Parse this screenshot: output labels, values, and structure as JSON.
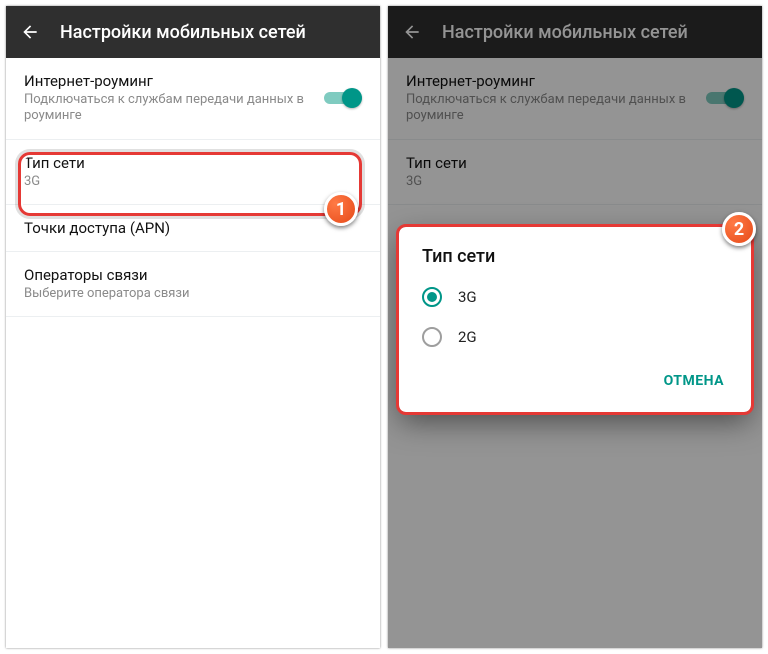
{
  "appbar": {
    "title": "Настройки мобильных сетей"
  },
  "colors": {
    "accent": "#009688",
    "highlight": "#e53935",
    "badge": "#e64a19"
  },
  "steps": {
    "one": "1",
    "two": "2"
  },
  "rows": {
    "roaming": {
      "title": "Интернет-роуминг",
      "sub": "Подключаться к службам передачи данных в роуминге",
      "toggle": true
    },
    "network_type": {
      "title": "Тип сети",
      "sub": "3G"
    },
    "apn": {
      "title": "Точки доступа (APN)"
    },
    "operators": {
      "title": "Операторы связи",
      "sub": "Выберите оператора связи"
    }
  },
  "dialog": {
    "title": "Тип сети",
    "options": {
      "g3": "3G",
      "g2": "2G"
    },
    "selected": "g3",
    "cancel": "ОТМЕНА"
  }
}
